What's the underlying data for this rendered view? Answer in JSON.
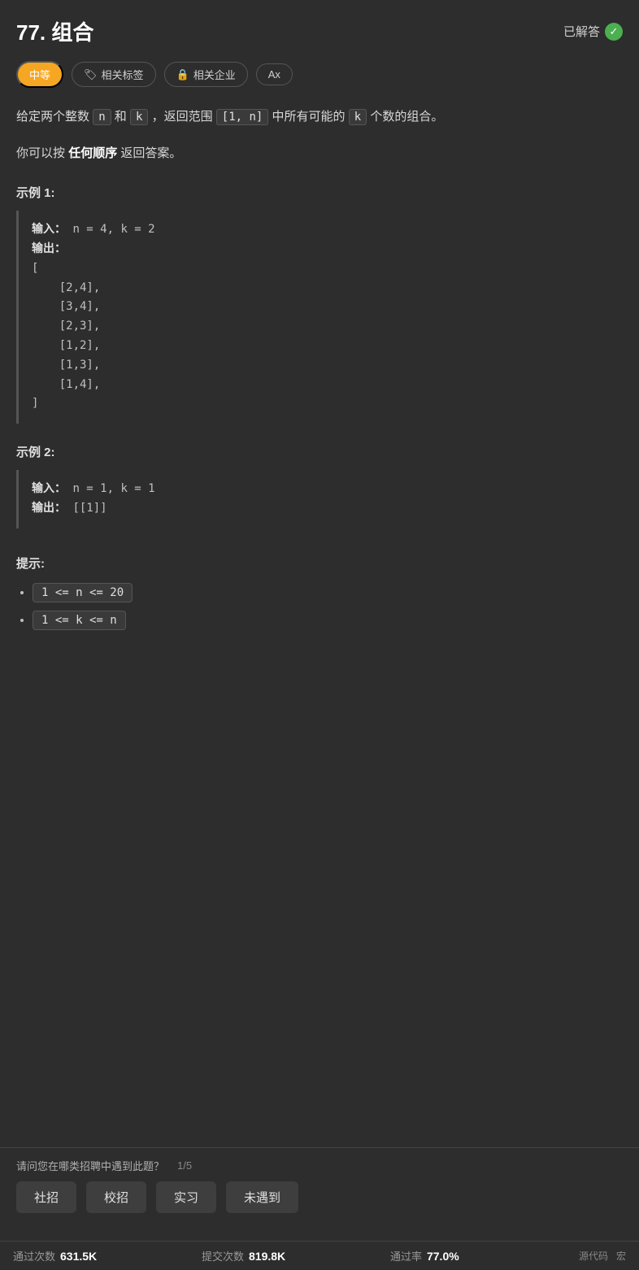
{
  "header": {
    "title": "77. 组合",
    "solved_label": "已解答",
    "solved_icon": "✓"
  },
  "tags": [
    {
      "id": "difficulty",
      "label": "中等",
      "type": "difficulty"
    },
    {
      "id": "related-tags",
      "label": "相关标签",
      "type": "outline",
      "icon": "🏷"
    },
    {
      "id": "related-companies",
      "label": "相关企业",
      "type": "outline",
      "icon": "🔒"
    },
    {
      "id": "font-size",
      "label": "Ax",
      "type": "outline"
    }
  ],
  "description": {
    "line1_prefix": "给定两个整数",
    "n_code": "n",
    "and_text": "和",
    "k_code": "k",
    "line1_mid": "，返回范围",
    "range_code": "[1, n]",
    "line1_suffix": "中所有可能的",
    "k_code2": "k",
    "line1_end": "个数的组合。",
    "line2": "你可以按",
    "bold_text": "任何顺序",
    "line2_end": "返回答案。"
  },
  "examples": [
    {
      "label": "示例 1:",
      "input_label": "输入：",
      "input_value": "n = 4, k = 2",
      "output_label": "输出：",
      "output_value": "[\n    [2,4],\n    [3,4],\n    [2,3],\n    [1,2],\n    [1,3],\n    [1,4],\n]"
    },
    {
      "label": "示例 2:",
      "input_label": "输入：",
      "input_value": "n = 1, k = 1",
      "output_label": "输出：",
      "output_value": "[[1]]"
    }
  ],
  "hints": {
    "label": "提示:",
    "items": [
      "1 <= n <= 20",
      "1 <= k <= n"
    ]
  },
  "survey": {
    "question": "请问您在哪类招聘中遇到此题？",
    "progress": "1/5",
    "buttons": [
      "社招",
      "校招",
      "实习",
      "未遇到"
    ]
  },
  "stats": {
    "pass_count_label": "通过次数",
    "pass_count_value": "631.5K",
    "submit_count_label": "提交次数",
    "submit_count_value": "819.8K",
    "pass_rate_label": "通过率",
    "pass_rate_value": "77.0%",
    "footer_links": [
      "源代码",
      "宏"
    ]
  }
}
